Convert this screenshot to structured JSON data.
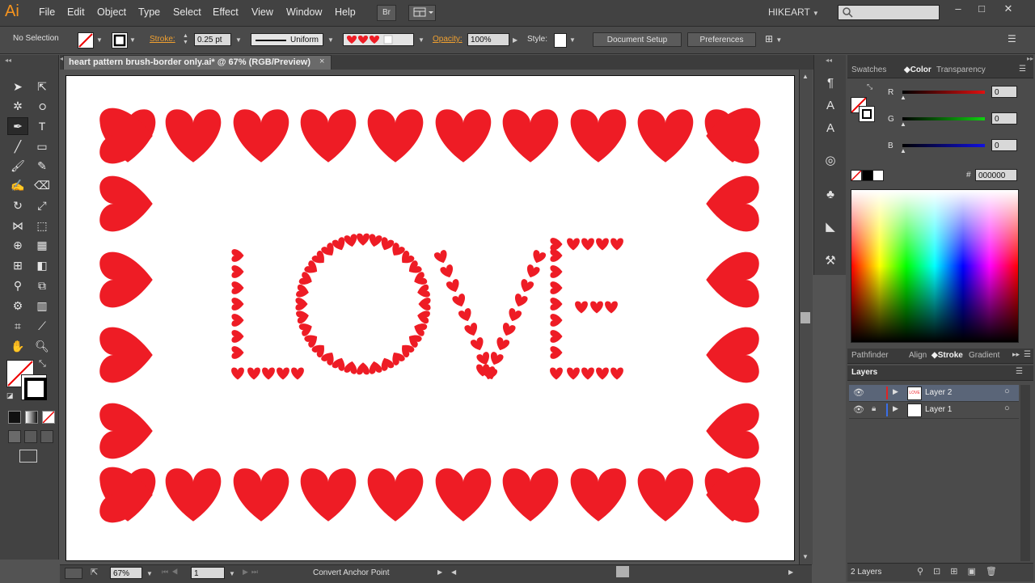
{
  "app": {
    "logo": "Ai",
    "workspace": "HIKEART",
    "bridge_label": "Br"
  },
  "menu": [
    "File",
    "Edit",
    "Object",
    "Type",
    "Select",
    "Effect",
    "View",
    "Window",
    "Help"
  ],
  "control_bar": {
    "selection": "No Selection",
    "stroke_label": "Stroke:",
    "stroke_weight": "0.25 pt",
    "profile": "Uniform",
    "opacity_label": "Opacity:",
    "opacity": "100%",
    "style_label": "Style:",
    "document_setup": "Document Setup",
    "preferences": "Preferences"
  },
  "document": {
    "tab_title": "heart pattern brush-border only.ai* @ 67% (RGB/Preview)",
    "close": "×"
  },
  "artwork": {
    "word": "LOVE",
    "heart_color": "#ee1c25"
  },
  "status_bar": {
    "zoom": "67%",
    "artboard": "1",
    "tool": "Convert Anchor Point"
  },
  "color_panel": {
    "tabs": [
      "Swatches",
      "Color",
      "Transparency"
    ],
    "active_tab": "Color",
    "channels": [
      {
        "label": "R",
        "value": "0",
        "color": "#e01010"
      },
      {
        "label": "G",
        "value": "0",
        "color": "#10d010"
      },
      {
        "label": "B",
        "value": "0",
        "color": "#1010e0"
      }
    ],
    "hex_label": "#",
    "hex": "000000"
  },
  "stroke_panel": {
    "tabs": [
      "Pathfinder",
      "Align",
      "Stroke",
      "Gradient"
    ],
    "active_tab": "Stroke"
  },
  "layers_panel": {
    "title": "Layers",
    "layers": [
      {
        "name": "Layer 2",
        "color": "#e02424",
        "locked": false,
        "thumb": "LOVE"
      },
      {
        "name": "Layer 1",
        "color": "#3a6ee8",
        "locked": true,
        "thumb": ""
      }
    ],
    "count": "2 Layers"
  }
}
